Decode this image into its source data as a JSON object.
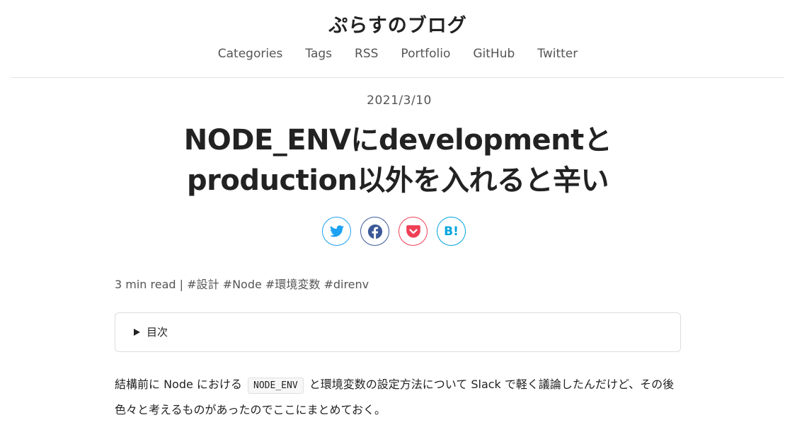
{
  "site": {
    "title": "ぷらすのブログ",
    "nav": [
      "Categories",
      "Tags",
      "RSS",
      "Portfolio",
      "GitHub",
      "Twitter"
    ]
  },
  "post": {
    "date": "2021/3/10",
    "title_line1": "NODE_ENVにdevelopmentと",
    "title_line2": "production以外を入れると辛い",
    "share": [
      {
        "icon": "twitter-icon",
        "color": "#1da1f2"
      },
      {
        "icon": "facebook-icon",
        "color": "#3b5998"
      },
      {
        "icon": "pocket-icon",
        "color": "#ef4056"
      },
      {
        "icon": "hatena-bookmark-icon",
        "color": "#00a4de",
        "label": "B!"
      }
    ],
    "read_time": "3 min read",
    "separator": "|",
    "tags": [
      "#設計",
      "#Node",
      "#環境変数",
      "#direnv"
    ],
    "toc_label": "目次",
    "body_before_code": "結構前に Node における ",
    "body_code": "NODE_ENV",
    "body_after_code": " と環境変数の設定方法について Slack で軽く議論したんだけど、その後色々と考えるものがあったのでここにまとめておく。"
  }
}
